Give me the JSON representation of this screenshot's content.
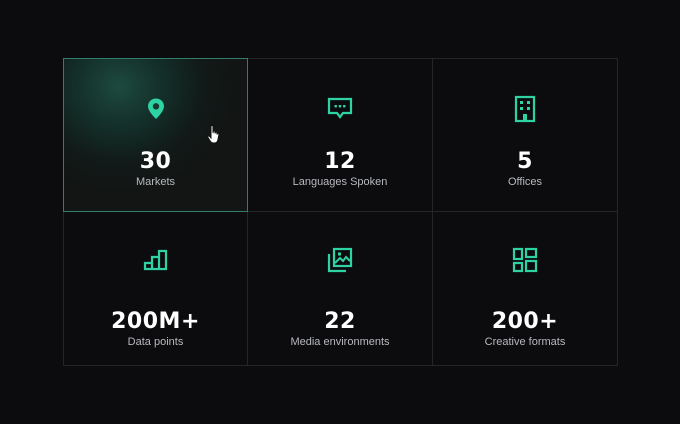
{
  "accent_color": "#2ed3a4",
  "stats": [
    {
      "value": "30",
      "label": "Markets",
      "icon": "map-pin-icon"
    },
    {
      "value": "12",
      "label": "Languages Spoken",
      "icon": "chat-bubble-icon"
    },
    {
      "value": "5",
      "label": "Offices",
      "icon": "building-icon"
    },
    {
      "value": "200M+",
      "label": "Data points",
      "icon": "bar-steps-icon"
    },
    {
      "value": "22",
      "label": "Media environments",
      "icon": "image-stack-icon"
    },
    {
      "value": "200+",
      "label": "Creative formats",
      "icon": "layout-grid-icon"
    }
  ]
}
